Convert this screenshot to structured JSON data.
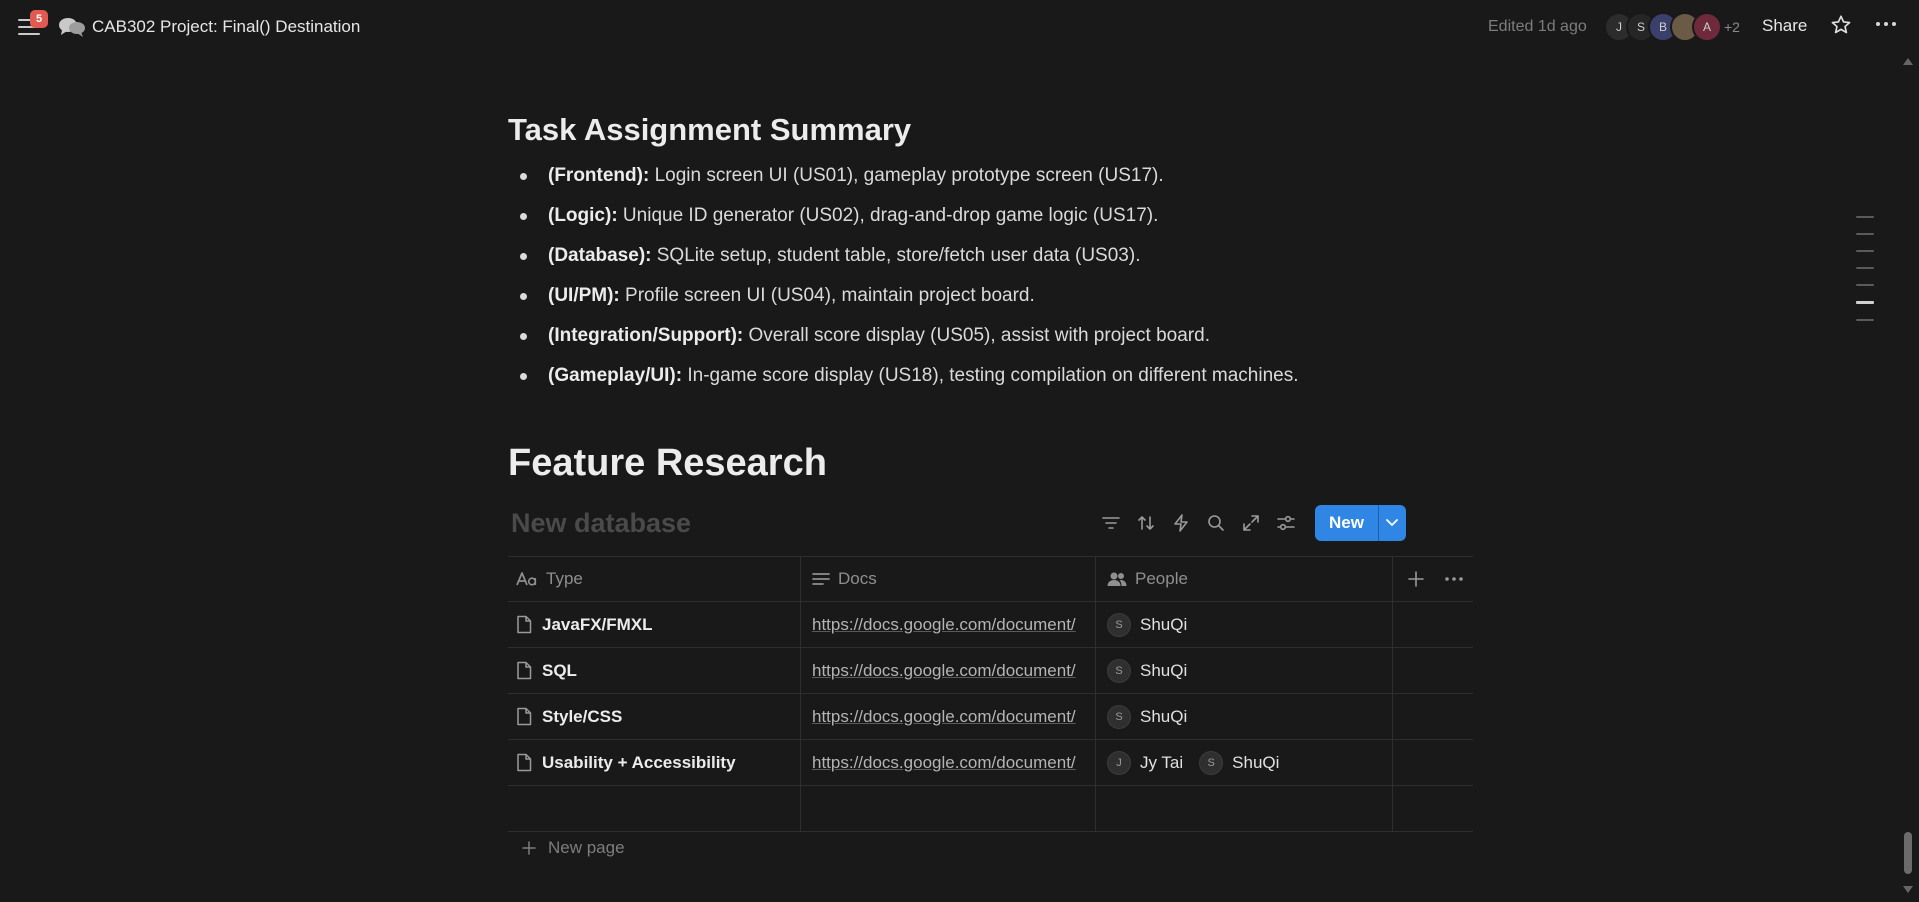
{
  "topbar": {
    "notification_count": "5",
    "title": "CAB302 Project: Final() Destination",
    "edited": "Edited 1d ago",
    "avatars": [
      {
        "initial": "J",
        "color": "#2c2c2c"
      },
      {
        "initial": "S",
        "color": "#262626"
      },
      {
        "initial": "B",
        "color": "#3a3f6b"
      },
      {
        "initial": "",
        "color": "#6b5a45"
      },
      {
        "initial": "A",
        "color": "#6e2a3a"
      }
    ],
    "more_count": "+2",
    "share_label": "Share"
  },
  "task_summary": {
    "heading": "Task Assignment Summary",
    "items": [
      {
        "role": "(Frontend):",
        "text": " Login screen UI (US01), gameplay prototype screen (US17)."
      },
      {
        "role": "(Logic):",
        "text": " Unique ID generator (US02), drag-and-drop game logic (US17)."
      },
      {
        "role": "(Database):",
        "text": " SQLite setup, student table, store/fetch user data (US03)."
      },
      {
        "role": "(UI/PM):",
        "text": " Profile screen UI (US04), maintain project board."
      },
      {
        "role": "(Integration/Support):",
        "text": " Overall score display (US05), assist with project board."
      },
      {
        "role": "(Gameplay/UI):",
        "text": " In-game score display (US18), testing compilation on different machines."
      }
    ]
  },
  "feature_research": {
    "heading": "Feature Research",
    "database_title": "New database",
    "new_button": "New",
    "columns": {
      "type": "Type",
      "docs": "Docs",
      "people": "People"
    },
    "rows": [
      {
        "type": "JavaFX/FMXL",
        "docs": "https://docs.google.com/document/",
        "people": [
          {
            "initial": "S",
            "name": "ShuQi"
          }
        ]
      },
      {
        "type": "SQL",
        "docs": "https://docs.google.com/document/",
        "people": [
          {
            "initial": "S",
            "name": "ShuQi"
          }
        ]
      },
      {
        "type": "Style/CSS",
        "docs": "https://docs.google.com/document/",
        "people": [
          {
            "initial": "S",
            "name": "ShuQi"
          }
        ]
      },
      {
        "type": "Usability + Accessibility",
        "docs": "https://docs.google.com/document/",
        "people": [
          {
            "initial": "J",
            "name": "Jy Tai"
          },
          {
            "initial": "S",
            "name": "ShuQi"
          }
        ]
      }
    ],
    "new_page": "New page"
  },
  "colors": {
    "background": "#191919",
    "accent": "#2f86e4",
    "badge": "#e05a4f"
  }
}
